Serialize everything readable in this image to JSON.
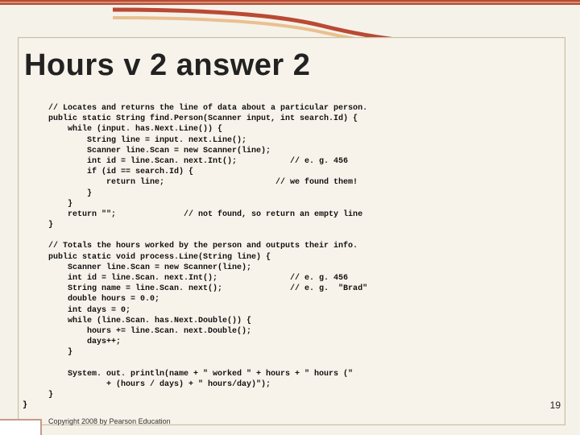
{
  "title": "Hours v 2 answer 2",
  "code_lines": [
    "// Locates and returns the line of data about a particular person.",
    "public static String find.Person(Scanner input, int search.Id) {",
    "    while (input. has.Next.Line()) {",
    "        String line = input. next.Line();",
    "        Scanner line.Scan = new Scanner(line);",
    "        int id = line.Scan. next.Int();           // e. g. 456",
    "        if (id == search.Id) {",
    "            return line;                       // we found them!",
    "        }",
    "    }",
    "    return \"\";              // not found, so return an empty line",
    "}",
    "",
    "// Totals the hours worked by the person and outputs their info.",
    "public static void process.Line(String line) {",
    "    Scanner line.Scan = new Scanner(line);",
    "    int id = line.Scan. next.Int();               // e. g. 456",
    "    String name = line.Scan. next();              // e. g.  \"Brad\"",
    "    double hours = 0.0;",
    "    int days = 0;",
    "    while (line.Scan. has.Next.Double()) {",
    "        hours += line.Scan. next.Double();",
    "        days++;",
    "    }",
    "",
    "    System. out. println(name + \" worked \" + hours + \" hours (\"",
    "            + (hours / days) + \" hours/day)\");",
    "}"
  ],
  "closing_brace": "}",
  "footer": "Copyright 2008 by Pearson Education",
  "page_number": "19"
}
